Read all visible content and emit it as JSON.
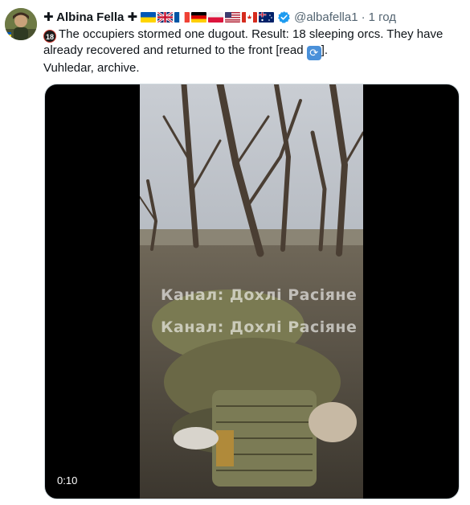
{
  "author": {
    "display_name": "✚ Albina Fella ✚",
    "handle": "@albafella1",
    "separator": "·",
    "time": "1 год",
    "flags": [
      "ukraine-flag",
      "uk-flag",
      "france-flag",
      "germany-flag",
      "poland-flag",
      "usa-flag",
      "canada-flag",
      "australia-flag"
    ],
    "verified": true
  },
  "tweet": {
    "age_badge": "18",
    "line1": "The occupiers stormed one dugout. Result: 18 sleeping orcs. They have already recovered and returned to the front [read ",
    "line1_end": "].",
    "line2": "Vuhledar, archive."
  },
  "video": {
    "watermark_1": "Канал: Дохлі Расіяне",
    "watermark_2": "Канал: Дохлі Расіяне",
    "duration": "0:10"
  },
  "colors": {
    "text": "#0f1419",
    "secondary": "#536471",
    "verified": "#1d9bf0"
  }
}
